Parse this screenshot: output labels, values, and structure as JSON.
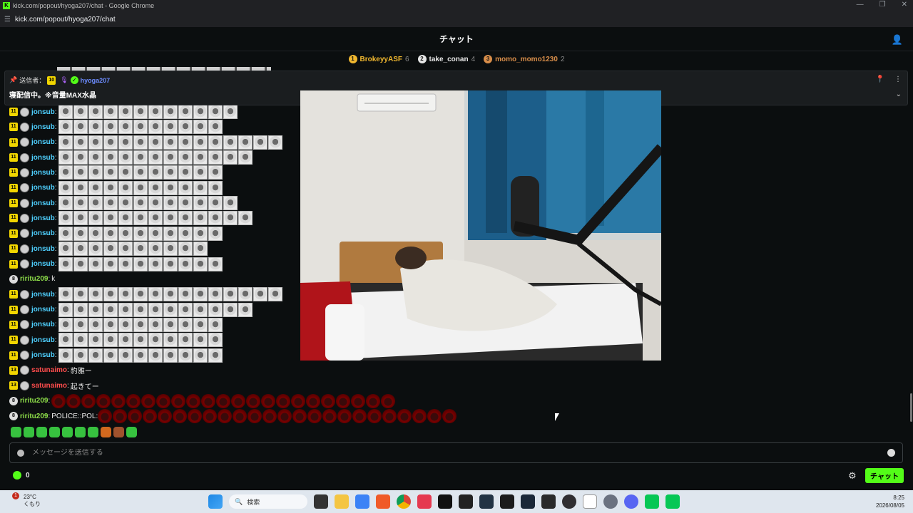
{
  "window": {
    "title": "kick.com/popout/hyoga207/chat - Google Chrome",
    "url": "kick.com/popout/hyoga207/chat"
  },
  "header": {
    "title": "チャット"
  },
  "leaderboard": [
    {
      "rank": "1",
      "name": "BrokeyyASF",
      "count": "6",
      "color": "#f0b72f"
    },
    {
      "rank": "2",
      "name": "take_conan",
      "count": "4",
      "color": "#e6e6e6"
    },
    {
      "rank": "3",
      "name": "momo_momo1230",
      "count": "2",
      "color": "#d98e4a"
    }
  ],
  "pinned": {
    "label": "送信者：",
    "badge": "10",
    "sender": "hyoga207",
    "text": "寝配信中。※音量MAX水晶"
  },
  "messages": [
    {
      "badge": "11",
      "badge_type": "sub",
      "user": "jonsub",
      "color": "#4fd0ff",
      "emotes": 12,
      "emote_type": "face",
      "text": ""
    },
    {
      "badge": "11",
      "badge_type": "sub",
      "user": "jonsub",
      "color": "#4fd0ff",
      "emotes": 11,
      "emote_type": "face",
      "text": ""
    },
    {
      "badge": "11",
      "badge_type": "sub",
      "user": "jonsub",
      "color": "#4fd0ff",
      "emotes": 15,
      "emote_type": "face",
      "text": ""
    },
    {
      "badge": "11",
      "badge_type": "sub",
      "user": "jonsub",
      "color": "#4fd0ff",
      "emotes": 13,
      "emote_type": "face",
      "text": ""
    },
    {
      "badge": "11",
      "badge_type": "sub",
      "user": "jonsub",
      "color": "#4fd0ff",
      "emotes": 11,
      "emote_type": "face",
      "text": ""
    },
    {
      "badge": "11",
      "badge_type": "sub",
      "user": "jonsub",
      "color": "#4fd0ff",
      "emotes": 11,
      "emote_type": "face",
      "text": ""
    },
    {
      "badge": "11",
      "badge_type": "sub",
      "user": "jonsub",
      "color": "#4fd0ff",
      "emotes": 12,
      "emote_type": "face",
      "text": ""
    },
    {
      "badge": "11",
      "badge_type": "sub",
      "user": "jonsub",
      "color": "#4fd0ff",
      "emotes": 13,
      "emote_type": "face",
      "text": ""
    },
    {
      "badge": "11",
      "badge_type": "sub",
      "user": "jonsub",
      "color": "#4fd0ff",
      "emotes": 11,
      "emote_type": "face",
      "text": ""
    },
    {
      "badge": "11",
      "badge_type": "sub",
      "user": "jonsub",
      "color": "#4fd0ff",
      "emotes": 10,
      "emote_type": "face",
      "text": ""
    },
    {
      "badge": "11",
      "badge_type": "sub",
      "user": "jonsub",
      "color": "#4fd0ff",
      "emotes": 11,
      "emote_type": "face",
      "text": ""
    },
    {
      "badge": "8",
      "badge_type": "round",
      "user": "riritu209",
      "color": "#8fe04a",
      "emotes": 0,
      "emote_type": "",
      "text": "k"
    },
    {
      "badge": "11",
      "badge_type": "sub",
      "user": "jonsub",
      "color": "#4fd0ff",
      "emotes": 15,
      "emote_type": "face",
      "text": ""
    },
    {
      "badge": "11",
      "badge_type": "sub",
      "user": "jonsub",
      "color": "#4fd0ff",
      "emotes": 13,
      "emote_type": "face",
      "text": ""
    },
    {
      "badge": "11",
      "badge_type": "sub",
      "user": "jonsub",
      "color": "#4fd0ff",
      "emotes": 11,
      "emote_type": "face",
      "text": ""
    },
    {
      "badge": "11",
      "badge_type": "sub",
      "user": "jonsub",
      "color": "#4fd0ff",
      "emotes": 11,
      "emote_type": "face",
      "text": ""
    },
    {
      "badge": "11",
      "badge_type": "sub",
      "user": "jonsub",
      "color": "#4fd0ff",
      "emotes": 11,
      "emote_type": "face",
      "text": ""
    },
    {
      "badge": "13",
      "badge_type": "sub",
      "user": "satunaimo",
      "color": "#ff4d4d",
      "emotes": 0,
      "emote_type": "",
      "text": "豹雅ー"
    },
    {
      "badge": "13",
      "badge_type": "sub",
      "user": "satunaimo",
      "color": "#ff4d4d",
      "emotes": 0,
      "emote_type": "",
      "text": "起きてー"
    },
    {
      "badge": "8",
      "badge_type": "round",
      "user": "riritu209",
      "color": "#8fe04a",
      "emotes": 23,
      "emote_type": "red",
      "text": ""
    },
    {
      "badge": "8",
      "badge_type": "round",
      "user": "riritu209",
      "color": "#8fe04a",
      "emotes": 24,
      "emote_type": "red",
      "text": "POLICE::POL:"
    }
  ],
  "input": {
    "placeholder": "メッセージを送信する"
  },
  "footer": {
    "points": "0",
    "send_label": "チャット"
  },
  "taskbar": {
    "weather_temp": "23°C",
    "weather_desc": "くもり",
    "notif_count": "1",
    "search_placeholder": "検索",
    "time": "8:25",
    "date": "2026/08/05"
  }
}
